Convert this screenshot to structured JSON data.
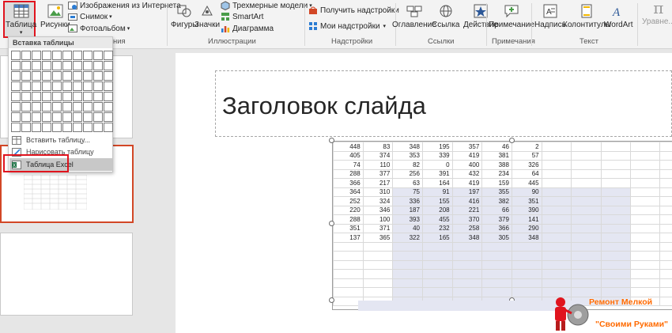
{
  "ribbon": {
    "table": "Таблица",
    "pictures": "Рисунки",
    "online_pictures": "Изображения из Интернета",
    "screenshot": "Снимок",
    "photo_album": "Фотоальбом",
    "shapes": "Фигуры",
    "icons": "Значки",
    "models_3d": "Трехмерные модели",
    "smartart": "SmartArt",
    "chart": "Диаграмма",
    "get_addins": "Получить надстройки",
    "my_addins": "Мои надстройки",
    "zoom": "Оглавление",
    "link": "Ссылка",
    "action": "Действие",
    "comment": "Примечание",
    "textbox": "Надпись",
    "header_footer": "Колонтитулы",
    "wordart": "WordArt",
    "equation": "Уравне...",
    "group_images_tail": "ния",
    "group_illustrations": "Иллюстрации",
    "group_addins": "Надстройки",
    "group_links": "Ссылки",
    "group_comments": "Примечания",
    "group_text": "Текст"
  },
  "dropdown": {
    "header": "Вставка таблицы",
    "insert_table": "Вставить таблицу...",
    "draw_table": "Нарисовать таблицу",
    "excel_table": "Таблица Excel"
  },
  "slide": {
    "title": "Заголовок слайда"
  },
  "sheet": {
    "rows": [
      [
        "448",
        "83",
        "348",
        "195",
        "357",
        "46",
        "2"
      ],
      [
        "405",
        "374",
        "353",
        "339",
        "419",
        "381",
        "57"
      ],
      [
        "74",
        "110",
        "82",
        "0",
        "400",
        "388",
        "326"
      ],
      [
        "288",
        "377",
        "256",
        "391",
        "432",
        "234",
        "64"
      ],
      [
        "366",
        "217",
        "63",
        "164",
        "419",
        "159",
        "445"
      ],
      [
        "364",
        "310",
        "75",
        "91",
        "197",
        "355",
        "90"
      ],
      [
        "252",
        "324",
        "336",
        "155",
        "416",
        "382",
        "351"
      ],
      [
        "220",
        "346",
        "187",
        "208",
        "221",
        "66",
        "390"
      ],
      [
        "288",
        "100",
        "393",
        "455",
        "370",
        "379",
        "141"
      ],
      [
        "351",
        "371",
        "40",
        "232",
        "258",
        "366",
        "290"
      ],
      [
        "137",
        "365",
        "322",
        "165",
        "348",
        "305",
        "348"
      ]
    ]
  },
  "watermark": {
    "line1": "Ремонт Мелкой",
    "line2": "\"Своими Руками\""
  },
  "colors": {
    "accent_red": "#e0141e",
    "selection_orange": "#d24726",
    "sheet_shade": "#e4e6f2",
    "watermark_orange": "#ff6a00"
  }
}
